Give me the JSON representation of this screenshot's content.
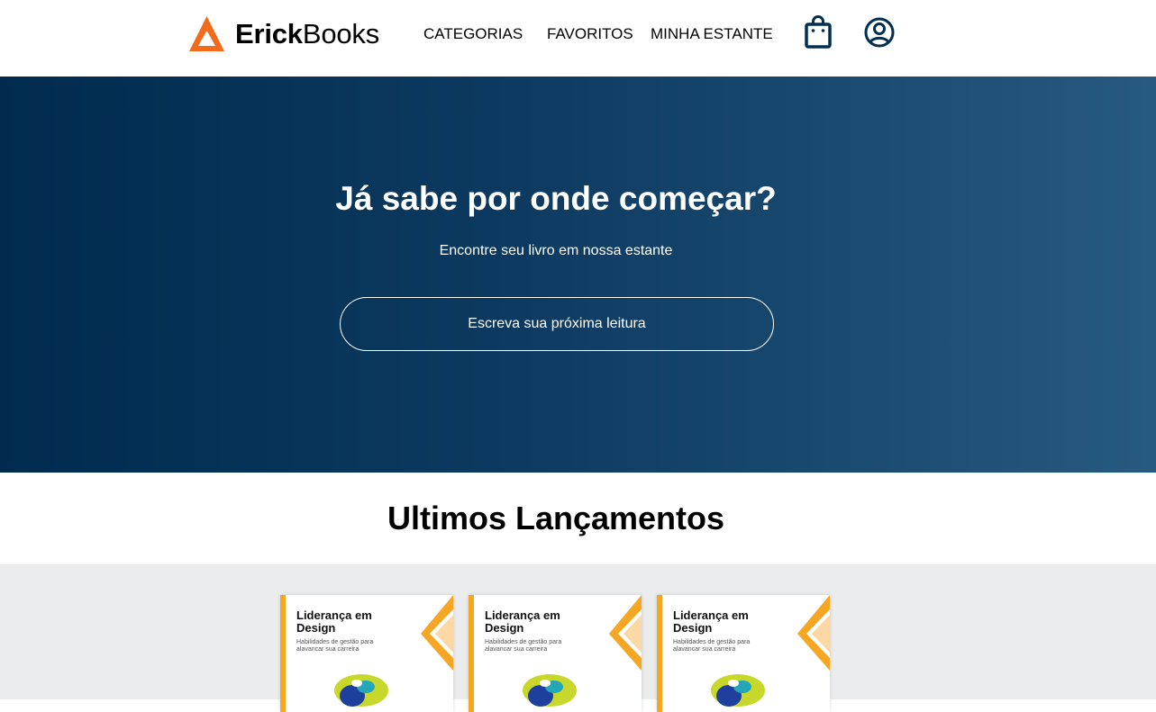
{
  "header": {
    "logo_bold": "Erick",
    "logo_regular": "Books",
    "logo_icon": "triangle-logo-icon",
    "nav": [
      "CATEGORIAS",
      "FAVORITOS",
      "MINHA ESTANTE"
    ],
    "bag_icon": "shopping-bag-icon",
    "user_icon": "user-profile-icon"
  },
  "hero": {
    "title": "Já sabe por onde começar?",
    "subtitle": "Encontre seu livro em nossa estante",
    "search_placeholder": "Escreva sua próxima leitura"
  },
  "releases": {
    "title": "Ultimos Lançamentos",
    "books": [
      {
        "title": "Liderança em Design",
        "subtitle": "Habilidades de gestão para alavancar sua carreira"
      },
      {
        "title": "Liderança em Design",
        "subtitle": "Habilidades de gestão para alavancar sua carreira"
      },
      {
        "title": "Liderança em Design",
        "subtitle": "Habilidades de gestão para alavancar sua carreira"
      }
    ]
  },
  "colors": {
    "brand_orange": "#f26b1d",
    "hero_dark": "#002b4f",
    "hero_light": "#275a80",
    "icon_navy": "#002f52",
    "book_accent": "#f5a623"
  }
}
